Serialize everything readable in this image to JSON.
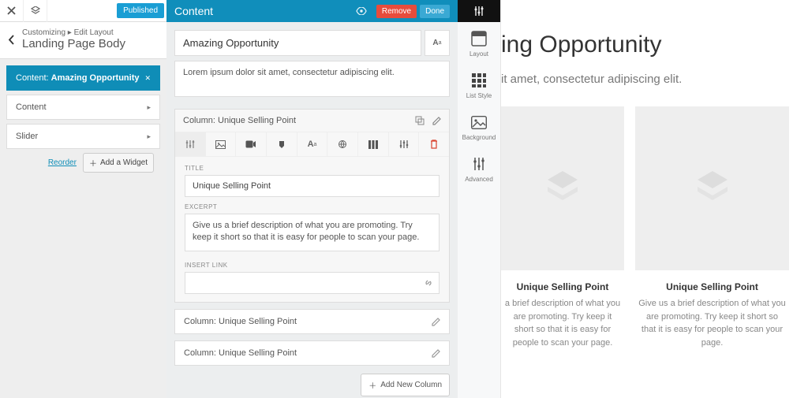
{
  "leftbar": {
    "published": "Published",
    "crumb": "Customizing ▸ Edit Layout",
    "title": "Landing Page Body",
    "items": [
      {
        "label_prefix": "Content:",
        "label_bold": "Amazing Opportunity",
        "active": true
      },
      {
        "label": "Content"
      },
      {
        "label": "Slider"
      }
    ],
    "reorder": "Reorder",
    "add_widget": "Add a Widget"
  },
  "editor": {
    "header_title": "Content",
    "remove": "Remove",
    "done": "Done",
    "heading_value": "Amazing Opportunity",
    "body_value": "Lorem ipsum dolor sit amet, consectetur adipiscing elit.",
    "column_open": {
      "title": "Column: Unique Selling Point",
      "field_title_label": "TITLE",
      "field_title_value": "Unique Selling Point",
      "field_excerpt_label": "EXCERPT",
      "field_excerpt_value": "Give us a brief description of what you are promoting. Try keep it short so that it is easy for people to scan your page.",
      "field_link_label": "INSERT LINK",
      "field_link_value": ""
    },
    "columns_collapsed": [
      "Column: Unique Selling Point",
      "Column: Unique Selling Point"
    ],
    "add_column": "Add New Column"
  },
  "tools": {
    "items": [
      {
        "name": "layout",
        "label": "Layout"
      },
      {
        "name": "liststyle",
        "label": "List Style"
      },
      {
        "name": "background",
        "label": "Background"
      },
      {
        "name": "advanced",
        "label": "Advanced"
      }
    ]
  },
  "preview": {
    "title": "ing Opportunity",
    "subtitle": "it amet, consectetur adipiscing elit.",
    "card_title": "Unique Selling Point",
    "card1_desc": "a brief description of what you are promoting. Try keep it short so that it is easy for people to scan your page.",
    "card2_desc": "Give us a brief description of what you are promoting. Try keep it short so that it is easy for people to scan your page."
  }
}
